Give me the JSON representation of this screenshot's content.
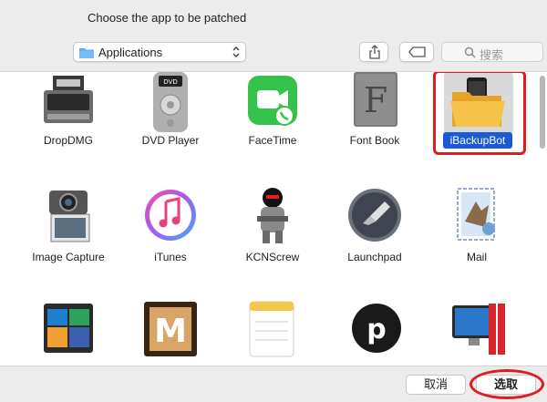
{
  "dialog": {
    "title": "Choose the app to be patched"
  },
  "toolbar": {
    "location": "Applications",
    "search_placeholder": "搜索"
  },
  "apps": [
    {
      "name": "DropDMG"
    },
    {
      "name": "DVD Player"
    },
    {
      "name": "FaceTime"
    },
    {
      "name": "Font Book"
    },
    {
      "name": "iBackupBot",
      "selected": true
    },
    {
      "name": "Image Capture"
    },
    {
      "name": "iTunes"
    },
    {
      "name": "KCNScrew"
    },
    {
      "name": "Launchpad"
    },
    {
      "name": "Mail"
    }
  ],
  "footer": {
    "cancel_label": "取消",
    "choose_label": "选取"
  },
  "colors": {
    "selection": "#1a5ad7",
    "highlight": "#e01c1c"
  }
}
